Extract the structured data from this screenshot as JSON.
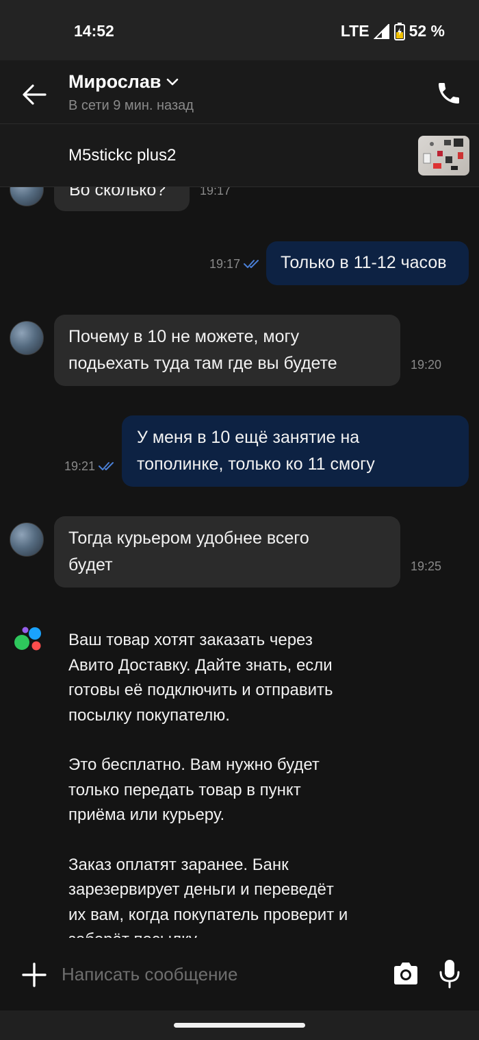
{
  "status_bar": {
    "time": "14:52",
    "network": "LTE",
    "battery": "52 %"
  },
  "header": {
    "contact_name": "Мирослав",
    "contact_status": "В сети 9 мин. назад"
  },
  "item": {
    "title": "M5stickc plus2"
  },
  "messages": [
    {
      "direction": "in",
      "text": "Во сколько?",
      "time": "19:17"
    },
    {
      "direction": "out",
      "text": "Только в 11-12 часов",
      "time": "19:17",
      "read": true
    },
    {
      "direction": "in",
      "lines": [
        "Почему в 10 не можете, могу",
        "подьехать туда там где вы будете"
      ],
      "time": "19:20"
    },
    {
      "direction": "out",
      "lines": [
        "У меня в 10 ещё занятие на",
        "тополинке, только ко 11 смогу"
      ],
      "time": "19:21",
      "read": true
    },
    {
      "direction": "in",
      "lines": [
        "Тогда курьером удобнее всего",
        "будет"
      ],
      "time": "19:25"
    }
  ],
  "system_message": {
    "paragraphs": [
      [
        "Ваш товар хотят заказать через",
        "Авито Доставку. Дайте знать, если",
        "готовы её подключить и отправить",
        "посылку покупателю."
      ],
      [
        "Это бесплатно. Вам нужно будет",
        "только передать товар в пункт",
        "приёма или курьеру."
      ],
      [
        "Заказ оплатят заранее. Банк",
        "зарезервирует деньги и переведёт",
        "их вам, когда покупатель проверит и",
        "заберёт посылку."
      ]
    ]
  },
  "composer": {
    "placeholder": "Написать сообщение"
  },
  "colors": {
    "background": "#141414",
    "incoming_bubble": "#2b2b2b",
    "outgoing_bubble": "#0d2243",
    "read_tick": "#4a7fd6"
  },
  "icons": [
    "back-arrow-icon",
    "chevron-down-icon",
    "phone-icon",
    "read-ticks-icon",
    "avito-logo-icon",
    "plus-icon",
    "camera-icon",
    "mic-icon",
    "signal-icon",
    "battery-icon"
  ]
}
